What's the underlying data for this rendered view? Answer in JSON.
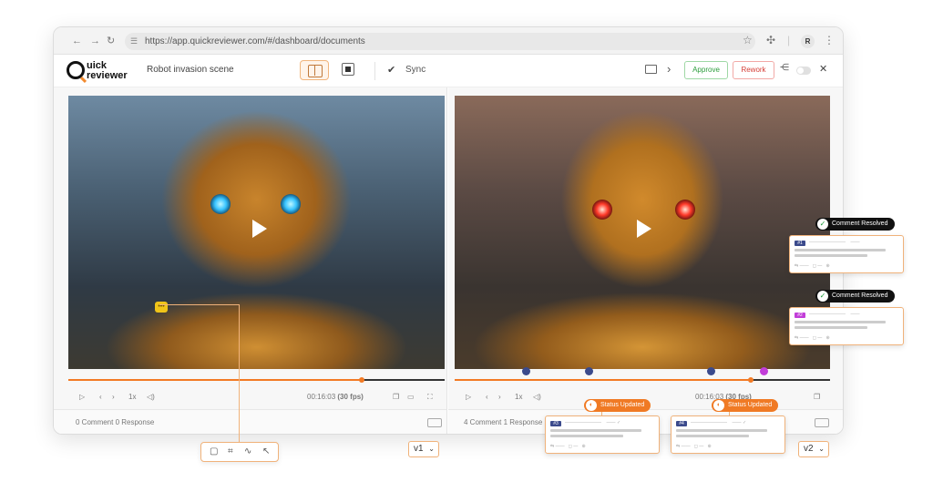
{
  "browser": {
    "url": "https://app.quickreviewer.com/#/dashboard/documents",
    "avatar_initial": "R"
  },
  "app": {
    "logo_line1": "uick",
    "logo_line2": "reviewer",
    "doc_title": "Robot invasion scene",
    "sync_label": "Sync",
    "approve_label": "Approve",
    "rework_label": "Rework"
  },
  "left_panel": {
    "speed": "1x",
    "timecode": "00:16:03",
    "fps": "(30 fps)",
    "progress_pct": 78,
    "footer": "0 Comment 0 Response",
    "version": "v1"
  },
  "right_panel": {
    "speed": "1x",
    "timecode": "00:16:03",
    "fps": "(30 fps)",
    "progress_pct": 79,
    "footer": "4 Comment 1 Response",
    "version": "v2",
    "marker_colors": [
      "#3b4a8c",
      "#3b4a8c",
      "#3b4a8c",
      "#c23ed8"
    ]
  },
  "overlays": {
    "resolved_label_1": "Comment Resolved",
    "resolved_label_2": "Comment Resolved",
    "status_label_1": "Status Updated",
    "status_label_2": "Status Updated",
    "cards": [
      {
        "num": "#1",
        "color": "#3b4a8c"
      },
      {
        "num": "#2",
        "color": "#c23ed8"
      },
      {
        "num": "#3",
        "color": "#3b4a8c"
      },
      {
        "num": "#4",
        "color": "#3b4a8c"
      }
    ]
  },
  "colors": {
    "accent": "#f27a24",
    "approve": "#2c9d3c",
    "rework": "#d53d36"
  }
}
